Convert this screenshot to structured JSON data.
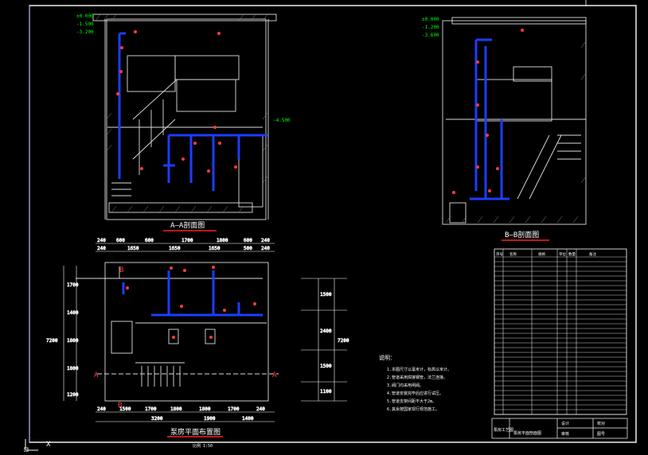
{
  "drawing": {
    "section_aa_title": "A—A剖面图",
    "section_bb_title": "B—B剖面图",
    "plan_title": "泵房平面布置图",
    "section_letters": {
      "a": "A",
      "b": "B"
    },
    "ucs_x_label": "X",
    "colors": {
      "background": "#000000",
      "frame": "#ffffff",
      "wall": "#dddddd",
      "pipe": "#1e3cff",
      "dimension": "#ffffff",
      "elevation": "#00ff00",
      "callout": "#ff3b3b",
      "table": "#ffffff",
      "title_underline": "#ff2020"
    }
  },
  "dimensions": {
    "plan_top_row1": [
      "240",
      "600",
      "600",
      "1700",
      "1800",
      "600",
      "240"
    ],
    "plan_top_row2": [
      "240",
      "1650",
      "1650",
      "1650",
      "500",
      "240"
    ],
    "plan_bottom_row1": [
      "240",
      "1500",
      "1700",
      "1800",
      "1800",
      "1700",
      "240"
    ],
    "plan_bottom_row2": [
      "3200",
      "1900",
      "1400"
    ],
    "plan_left": [
      "1700",
      "1400",
      "1800",
      "1800",
      "1200"
    ],
    "plan_left_total": "7200",
    "right_col": [
      "1500",
      "2400",
      "1500",
      "1100"
    ],
    "right_total": "7200",
    "scale_note": "比例 1:50"
  },
  "notes": {
    "title": "说明：",
    "lines": [
      "1.本图尺寸以毫米计，标高以米计。",
      "2.管道采用焊接钢管，法兰连接。",
      "3.阀门均采用闸阀。",
      "4.管道安装完毕后应进行试压。",
      "5.管道支架间距不大于2m。",
      "6.其余按国家现行规范施工。"
    ]
  },
  "equipment_table": {
    "headers": [
      "序号",
      "名称",
      "规格",
      "单位",
      "数量",
      "备注"
    ],
    "row_count": 33
  },
  "title_block": {
    "project": "泵房工艺图",
    "drawing_name": "泵房平面剖面图",
    "fields": [
      "设计",
      "校对",
      "审核",
      "图号"
    ]
  },
  "elevations": {
    "aa": [
      "±0.000",
      "-1.500",
      "-3.200",
      "-4.500"
    ],
    "bb": [
      "±0.000",
      "-1.200",
      "-3.600"
    ]
  }
}
